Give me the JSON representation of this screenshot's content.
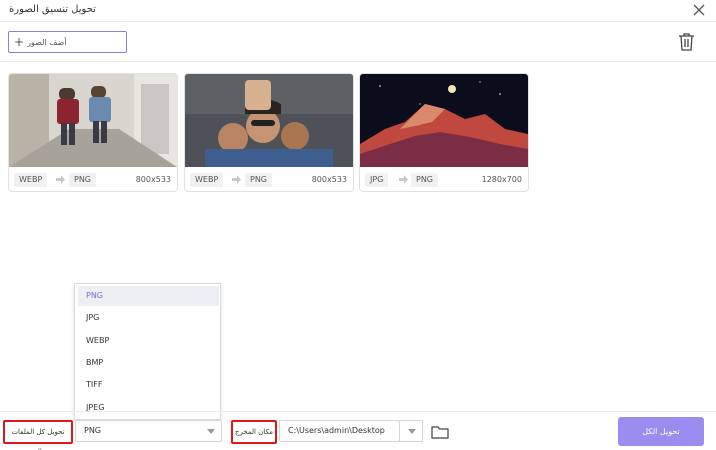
{
  "window": {
    "title": "تحويل تنسيق الصورة"
  },
  "toolbar": {
    "add_label": "أضف الصور",
    "add_icon": "+"
  },
  "images": [
    {
      "from": "WEBP",
      "to": "PNG",
      "dims": "800x533"
    },
    {
      "from": "WEBP",
      "to": "PNG",
      "dims": "800x533"
    },
    {
      "from": "JPG",
      "to": "PNG",
      "dims": "1280x700"
    }
  ],
  "format_options": [
    "PNG",
    "JPG",
    "WEBP",
    "BMP",
    "TIFF",
    "JPEG"
  ],
  "bottom": {
    "convert_all_to_label": "تحويل كل الملفات إلى:",
    "selected_format": "PNG",
    "output_location_label": "مكان المخرج",
    "output_path": "C:\\Users\\admin\\Desktop",
    "convert_all_button": "تحويل الكل"
  },
  "colors": {
    "accent": "#9b8df0",
    "highlight": "#e0141b",
    "selected_text": "#7b6ed6"
  }
}
